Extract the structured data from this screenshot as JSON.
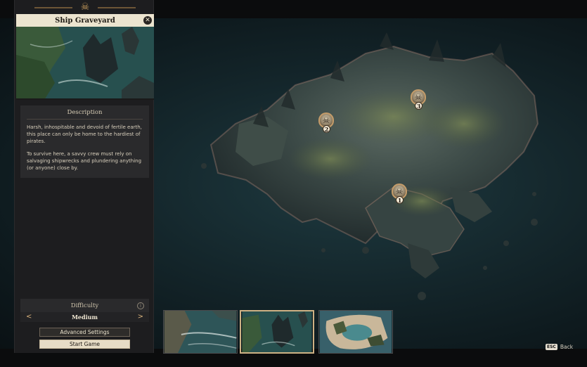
{
  "panel": {
    "title": "Ship Graveyard",
    "description": {
      "heading": "Description",
      "paragraphs": [
        "Harsh, inhospitable and devoid of fertile earth, this place can only be home to the hardiest of pirates.",
        "To survive here, a savvy crew must rely on salvaging shipwrecks and plundering anything (or anyone) close by."
      ]
    },
    "difficulty": {
      "label": "Difficulty",
      "value": "Medium",
      "prev_arrow": "<",
      "next_arrow": ">",
      "info_icon": "i"
    },
    "buttons": {
      "advanced": "Advanced Settings",
      "start": "Start Game"
    },
    "close_glyph": "✕"
  },
  "map": {
    "markers": [
      {
        "number": "2",
        "icon": "skull-icon"
      },
      {
        "number": "3",
        "icon": "skull-icon"
      },
      {
        "number": "1",
        "icon": "skull-icon"
      }
    ]
  },
  "thumbnails": {
    "selected_index": 1,
    "count": 3
  },
  "hint": {
    "key": "ESC",
    "label": "Back"
  },
  "colors": {
    "accent": "#c49c6a",
    "title_bar": "#ece4cf",
    "sea": "#1e3a40"
  }
}
